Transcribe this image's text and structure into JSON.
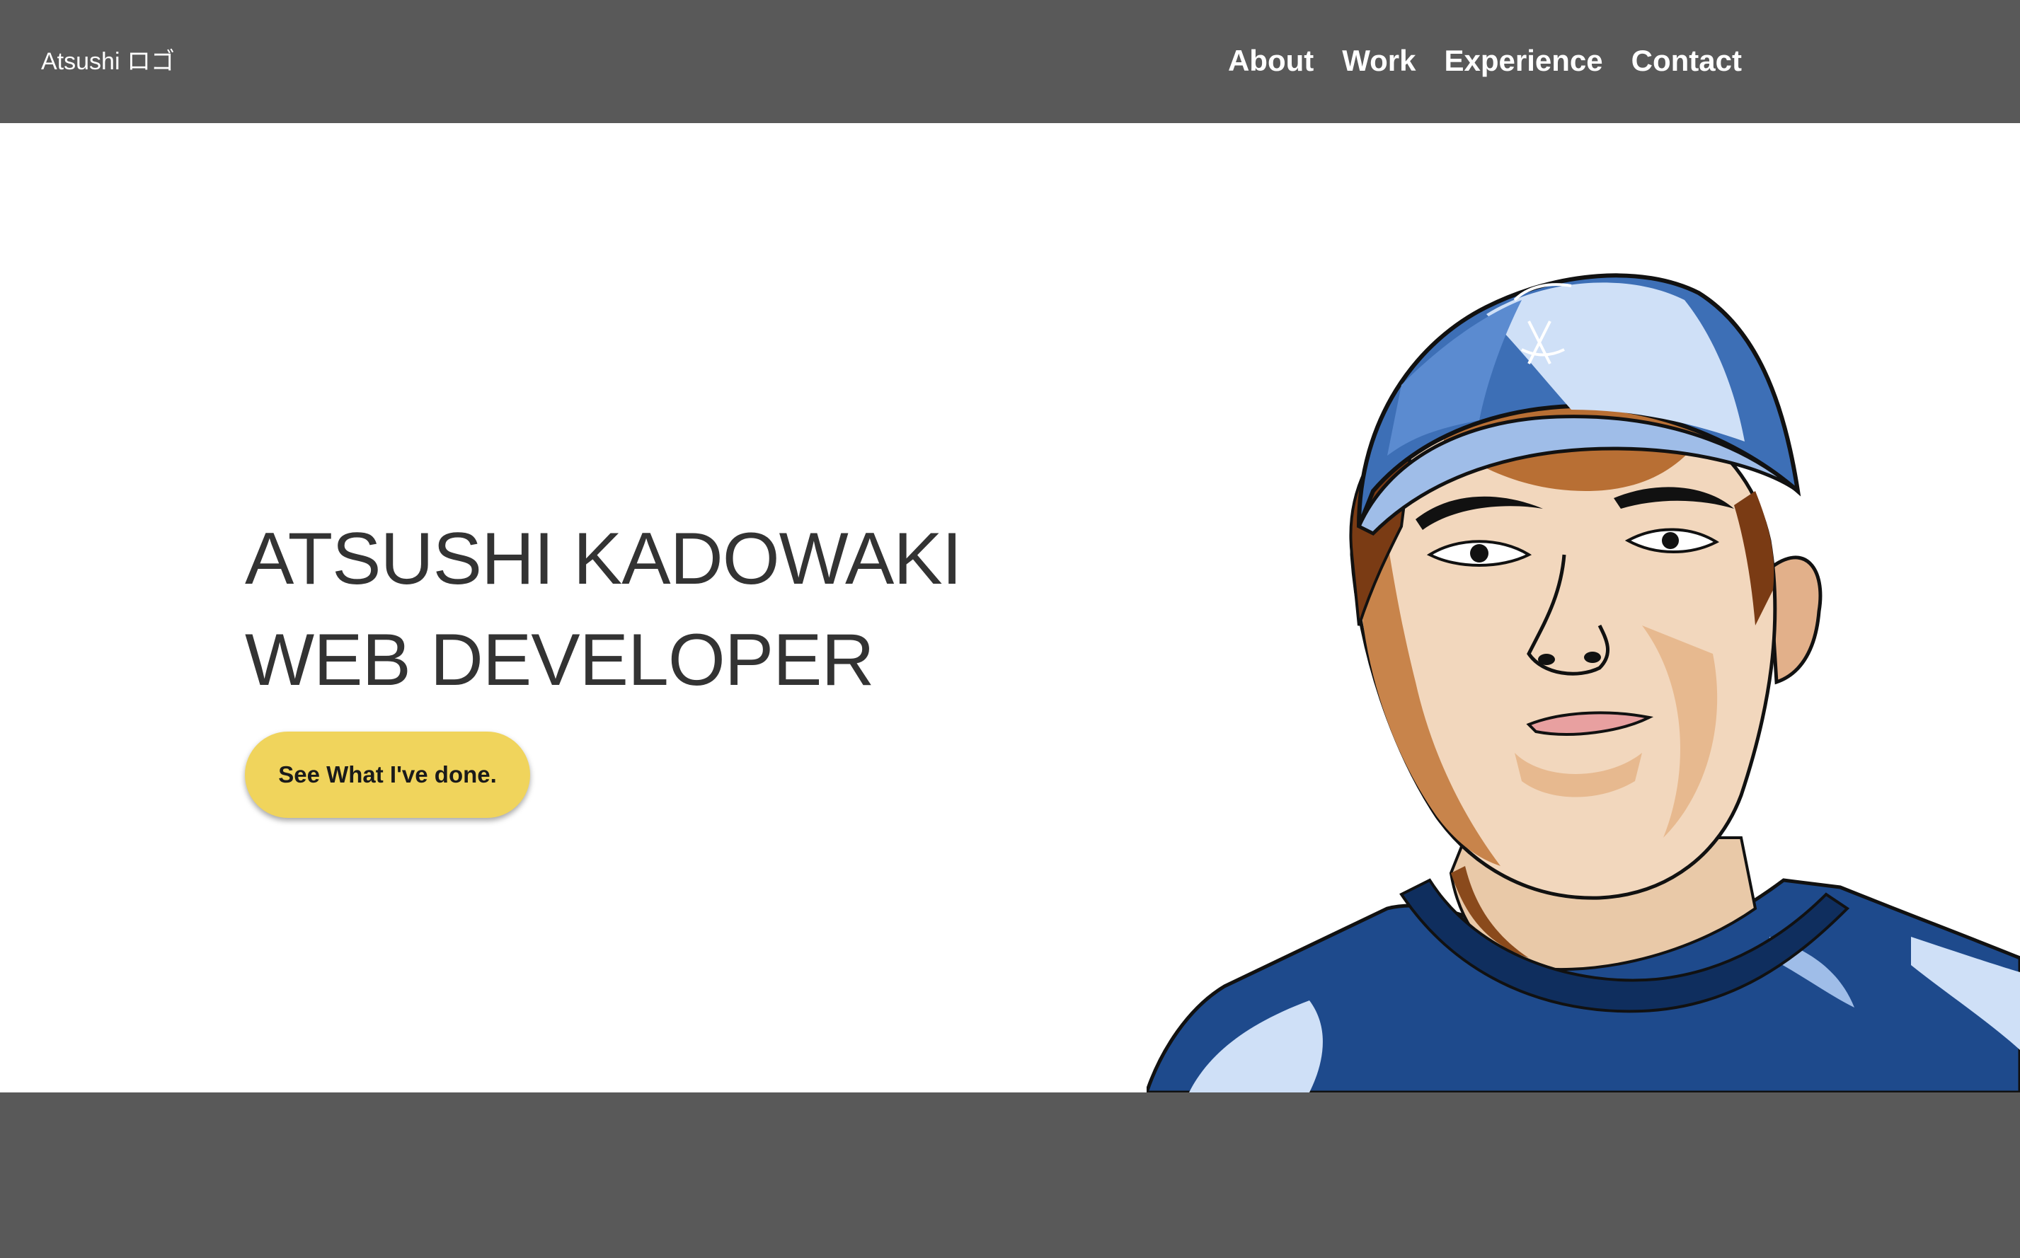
{
  "header": {
    "logo": "Atsushi ロゴ",
    "nav": [
      {
        "label": "About"
      },
      {
        "label": "Work"
      },
      {
        "label": "Experience"
      },
      {
        "label": "Contact"
      }
    ]
  },
  "hero": {
    "name": "ATSUSHI KADOWAKI",
    "role": "WEB DEVELOPER",
    "cta_label": "See What I've done."
  },
  "colors": {
    "header_bg": "#595959",
    "cta_bg": "#f0d45c",
    "title_text": "#333333"
  }
}
